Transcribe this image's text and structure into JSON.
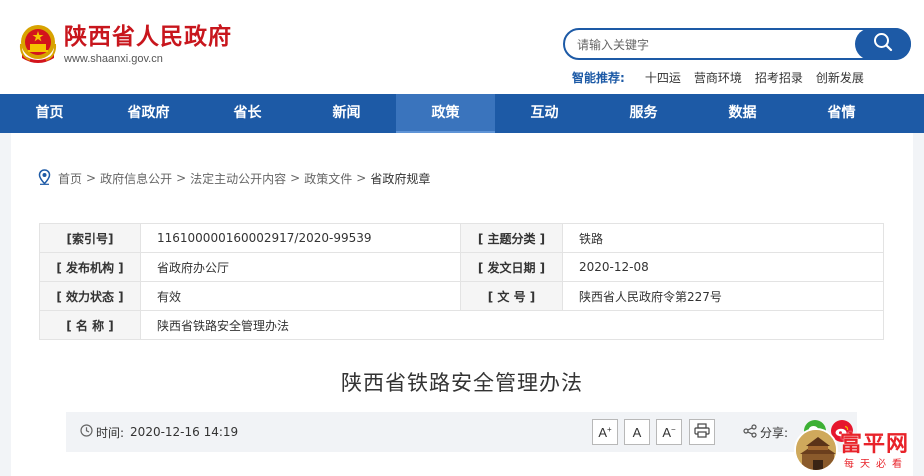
{
  "header": {
    "site_title": "陕西省人民政府",
    "site_url": "www.shaanxi.gov.cn",
    "search_placeholder": "请输入关键字",
    "smart_label": "智能推荐:",
    "smart_links": [
      "十四运",
      "营商环境",
      "招考招录",
      "创新发展"
    ]
  },
  "nav": {
    "items": [
      "首页",
      "省政府",
      "省长",
      "新闻",
      "政策",
      "互动",
      "服务",
      "数据",
      "省情"
    ],
    "active": "政策"
  },
  "breadcrumb": {
    "items": [
      "首页",
      "政府信息公开",
      "法定主动公开内容",
      "政策文件",
      "省政府规章"
    ],
    "separator": ">"
  },
  "info": {
    "index_no_label": "[索引号]",
    "index_no": "116100000160002917/2020-99539",
    "topic_label": "[ 主题分类 ]",
    "topic": "铁路",
    "issuer_label": "[ 发布机构 ]",
    "issuer": "省政府办公厅",
    "date_label": "[ 发文日期 ]",
    "date": "2020-12-08",
    "status_label": "[ 效力状态 ]",
    "status": "有效",
    "doc_no_label": "[ 文 号 ]",
    "doc_no": "陕西省人民政府令第227号",
    "name_label": "[ 名 称 ]",
    "name": "陕西省铁路安全管理办法"
  },
  "article": {
    "title": "陕西省铁路安全管理办法",
    "time_label": "时间:",
    "time": "2020-12-16 14:19",
    "font_large": "A",
    "font_medium": "A",
    "font_small": "A",
    "share_label": "分享:"
  },
  "watermark": {
    "title": "富平网",
    "subtitle": "每天必看"
  },
  "colors": {
    "brand_red": "#c8161d",
    "nav_blue": "#1d5aa6",
    "nav_active": "#3a74bd",
    "wechat_green": "#3cb034",
    "weibo_red": "#e6162d"
  }
}
